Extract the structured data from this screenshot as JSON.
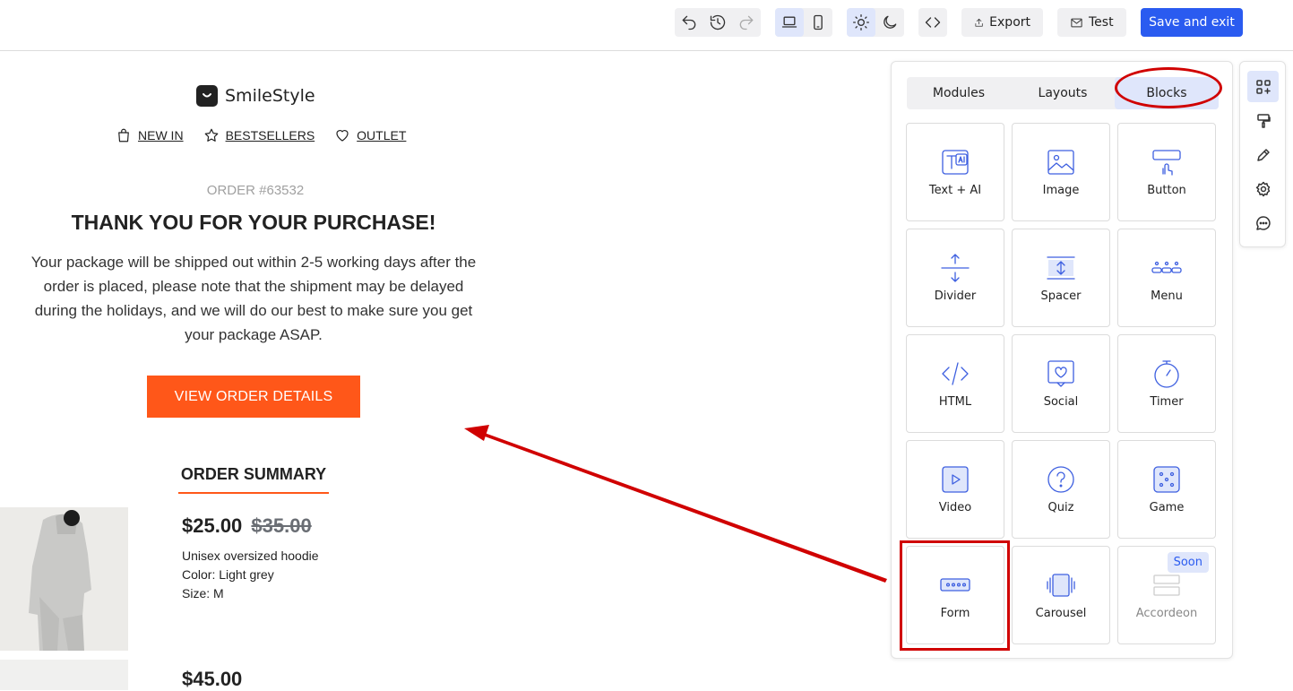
{
  "toolbar": {
    "export_label": "Export",
    "test_label": "Test",
    "save_label": "Save and exit"
  },
  "email": {
    "brand": "SmileStyle",
    "nav": [
      {
        "label": "NEW IN",
        "icon": "bag-icon"
      },
      {
        "label": "BESTSELLERS",
        "icon": "star-icon"
      },
      {
        "label": "OUTLET",
        "icon": "heart-icon"
      }
    ],
    "order_number": "ORDER #63532",
    "headline": "THANK YOU FOR YOUR PURCHASE!",
    "message": "Your package will be shipped out within 2-5 working days after the order is placed, please note that the shipment may be delayed during the holidays, and we will do our best to make sure you get your package ASAP.",
    "cta_label": "VIEW ORDER DETAILS",
    "summary_title": "ORDER SUMMARY",
    "products": [
      {
        "price": "$25.00",
        "old_price": "$35.00",
        "name": "Unisex oversized hoodie",
        "color": "Color: Light grey",
        "size": "Size: M"
      },
      {
        "price": "$45.00"
      }
    ]
  },
  "panel": {
    "tabs": [
      {
        "label": "Modules",
        "active": false
      },
      {
        "label": "Layouts",
        "active": false
      },
      {
        "label": "Blocks",
        "active": true
      }
    ],
    "blocks": [
      {
        "label": "Text + AI",
        "icon": "text-ai-icon"
      },
      {
        "label": "Image",
        "icon": "image-icon"
      },
      {
        "label": "Button",
        "icon": "button-icon"
      },
      {
        "label": "Divider",
        "icon": "divider-icon"
      },
      {
        "label": "Spacer",
        "icon": "spacer-icon"
      },
      {
        "label": "Menu",
        "icon": "menu-icon"
      },
      {
        "label": "HTML",
        "icon": "code-icon"
      },
      {
        "label": "Social",
        "icon": "social-icon"
      },
      {
        "label": "Timer",
        "icon": "timer-icon"
      },
      {
        "label": "Video",
        "icon": "video-icon"
      },
      {
        "label": "Quiz",
        "icon": "quiz-icon"
      },
      {
        "label": "Game",
        "icon": "game-icon"
      },
      {
        "label": "Form",
        "icon": "form-icon"
      },
      {
        "label": "Carousel",
        "icon": "carousel-icon"
      },
      {
        "label": "Accordeon",
        "icon": "accordeon-icon",
        "badge": "Soon"
      }
    ]
  },
  "colors": {
    "accent": "#2a5bf0",
    "cta": "#ff5719",
    "highlight": "#d00000"
  }
}
